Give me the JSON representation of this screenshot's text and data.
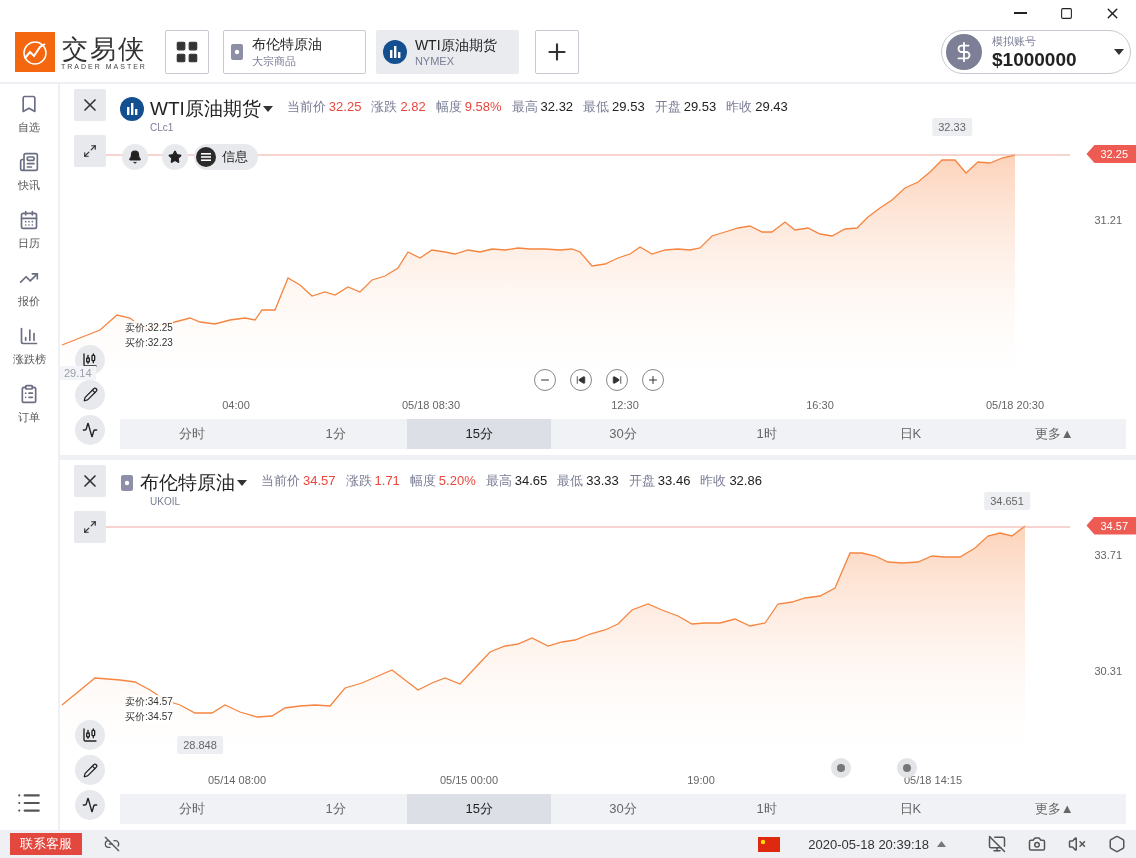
{
  "header": {
    "logo": {
      "name": "交易侠",
      "tagline": "TRADER MASTER"
    },
    "tabs": [
      {
        "title": "布伦特原油",
        "subtitle": "大宗商品",
        "kind": "commodity",
        "selected": false
      },
      {
        "title": "WTI原油期货",
        "subtitle": "NYMEX",
        "kind": "futures",
        "selected": true
      }
    ],
    "account": {
      "label": "模拟账号",
      "balance": "$1000000"
    }
  },
  "sidebar": {
    "items": [
      {
        "label": "自选",
        "kind": "bookmark"
      },
      {
        "label": "快讯",
        "kind": "news"
      },
      {
        "label": "日历",
        "kind": "calendar"
      },
      {
        "label": "报价",
        "kind": "quote"
      },
      {
        "label": "涨跌榜",
        "kind": "ranking"
      },
      {
        "label": "订单",
        "kind": "orders"
      }
    ]
  },
  "panels": [
    {
      "symbol": "WTI原油期货",
      "code": "CLc1",
      "kind": "futures",
      "stats": [
        {
          "label": "当前价",
          "value": "32.25",
          "rising": true
        },
        {
          "label": "涨跌",
          "value": "2.82",
          "rising": true
        },
        {
          "label": "幅度",
          "value": "9.58%",
          "rising": true
        },
        {
          "label": "最高",
          "value": "32.32",
          "rising": false
        },
        {
          "label": "最低",
          "value": "29.53",
          "rising": false
        },
        {
          "label": "开盘",
          "value": "29.53",
          "rising": false
        },
        {
          "label": "昨收",
          "value": "29.43",
          "rising": false
        }
      ],
      "actions": {
        "info": "信息"
      },
      "current_price": "32.25",
      "high_marker": "32.33",
      "y_labels": [
        "31.21"
      ],
      "faded_label": "29.14",
      "bid": "卖价:32.25",
      "ask": "买价:32.23",
      "x_labels": [
        "04:00",
        "05/18 08:30",
        "12:30",
        "16:30",
        "05/18 20:30"
      ],
      "zoom_controls": true,
      "periods": [
        {
          "label": "分时",
          "selected": false
        },
        {
          "label": "1分",
          "selected": false
        },
        {
          "label": "15分",
          "selected": true
        },
        {
          "label": "30分",
          "selected": false
        },
        {
          "label": "1时",
          "selected": false
        },
        {
          "label": "日K",
          "selected": false
        },
        {
          "label": "更多▲",
          "selected": false
        }
      ]
    },
    {
      "symbol": "布伦特原油",
      "code": "UKOIL",
      "kind": "commodity",
      "stats": [
        {
          "label": "当前价",
          "value": "34.57",
          "rising": true
        },
        {
          "label": "涨跌",
          "value": "1.71",
          "rising": true
        },
        {
          "label": "幅度",
          "value": "5.20%",
          "rising": true
        },
        {
          "label": "最高",
          "value": "34.65",
          "rising": false
        },
        {
          "label": "最低",
          "value": "33.33",
          "rising": false
        },
        {
          "label": "开盘",
          "value": "33.46",
          "rising": false
        },
        {
          "label": "昨收",
          "value": "32.86",
          "rising": false
        }
      ],
      "current_price": "34.57",
      "high_marker": "34.651",
      "low_marker": "28.848",
      "y_labels": [
        "33.71",
        "30.31"
      ],
      "bid": "卖价:34.57",
      "ask": "买价:34.57",
      "x_labels": [
        "05/14 08:00",
        "05/15 00:00",
        "19:00",
        "05/18 14:15"
      ],
      "zoom_controls": false,
      "periods": [
        {
          "label": "分时",
          "selected": false
        },
        {
          "label": "1分",
          "selected": false
        },
        {
          "label": "15分",
          "selected": true
        },
        {
          "label": "30分",
          "selected": false
        },
        {
          "label": "1时",
          "selected": false
        },
        {
          "label": "日K",
          "selected": false
        },
        {
          "label": "更多▲",
          "selected": false
        }
      ]
    }
  ],
  "status_bar": {
    "support_button": "联系客服",
    "datetime": "2020-05-18 20:39:18"
  }
}
